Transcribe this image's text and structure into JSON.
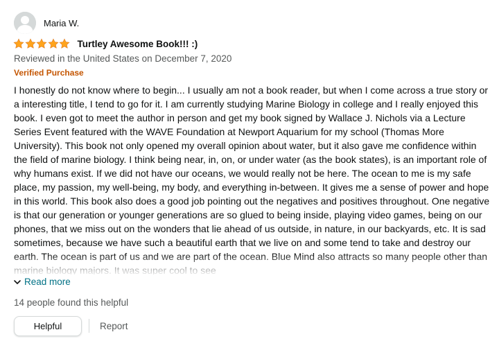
{
  "profile": {
    "name": "Maria W.",
    "avatar_icon": "user-avatar-icon"
  },
  "rating": {
    "stars": 5,
    "max_stars": 5,
    "star_color": "#ffa41c",
    "title": "Turtley Awesome Book!!! :)"
  },
  "review": {
    "date_line": "Reviewed in the United States on December 7, 2020",
    "verified_label": "Verified Purchase",
    "verified_color": "#c45500",
    "body": "I honestly do not know where to begin... I usually am not a book reader, but when I come across a true story or a interesting title, I tend to go for it. I am currently studying Marine Biology in college and I really enjoyed this book. I even got to meet the author in person and get my book signed by Wallace J. Nichols via a Lecture Series Event featured with the WAVE Foundation at Newport Aquarium for my school (Thomas More University). This book not only opened my overall opinion about water, but it also gave me confidence within the field of marine biology. I think being near, in, on, or under water (as the book states), is an important role of why humans exist. If we did not have our oceans, we would really not be here. The ocean to me is my safe place, my passion, my well-being, my body, and everything in-between. It gives me a sense of power and hope in this world. This book also does a good job pointing out the negatives and positives throughout. One negative is that our generation or younger generations are so glued to being inside, playing video games, being on our phones, that we miss out on the wonders that lie ahead of us outside, in nature, in our backyards, etc. It is sad sometimes, because we have such a beautiful earth that we live on and some tend to take and destroy our earth. The ocean is part of us and we are part of the ocean. Blue Mind also attracts so many people other than marine biology majors. It was super cool to see"
  },
  "read_more": {
    "label": "Read more",
    "icon": "chevron-down-icon",
    "link_color": "#007185"
  },
  "helpful_count_text": "14 people found this helpful",
  "actions": {
    "helpful_label": "Helpful",
    "report_label": "Report"
  }
}
